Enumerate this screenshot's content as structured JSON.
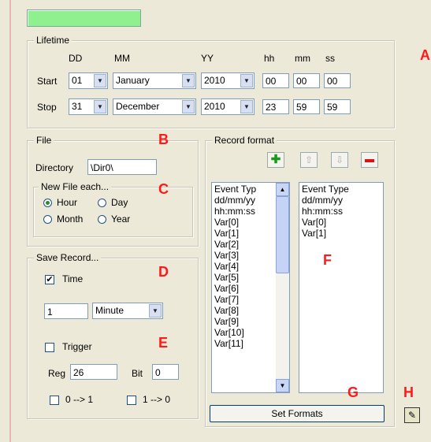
{
  "markers": {
    "A": "A",
    "B": "B",
    "C": "C",
    "D": "D",
    "E": "E",
    "F": "F",
    "G": "G",
    "H": "H"
  },
  "lifetime": {
    "legend": "Lifetime",
    "headers": {
      "dd": "DD",
      "mm": "MM",
      "yy": "YY",
      "hh": "hh",
      "min": "mm",
      "ss": "ss"
    },
    "start": {
      "label": "Start",
      "day": "01",
      "month": "January",
      "year": "2010",
      "hh": "00",
      "mm": "00",
      "ss": "00"
    },
    "stop": {
      "label": "Stop",
      "day": "31",
      "month": "December",
      "year": "2010",
      "hh": "23",
      "mm": "59",
      "ss": "59"
    }
  },
  "file": {
    "legend": "File",
    "directory_label": "Directory",
    "directory_value": "\\Dir0\\",
    "newfile_legend": "New File each...",
    "options": {
      "hour": "Hour",
      "day": "Day",
      "month": "Month",
      "year": "Year"
    },
    "selected": "Hour"
  },
  "save_record": {
    "legend": "Save Record...",
    "time_label": "Time",
    "time_checked": true,
    "interval_value": "1",
    "interval_unit": "Minute",
    "trigger_label": "Trigger",
    "trigger_checked": false,
    "reg_label": "Reg",
    "reg_value": "26",
    "bit_label": "Bit",
    "bit_value": "0",
    "edge_rising": "0 --> 1",
    "edge_falling": "1 --> 0"
  },
  "record_format": {
    "legend": "Record format",
    "available": [
      "Event Typ",
      "dd/mm/yy",
      "hh:mm:ss",
      "Var[0]",
      "Var[1]",
      "Var[2]",
      "Var[3]",
      "Var[4]",
      "Var[5]",
      "Var[6]",
      "Var[7]",
      "Var[8]",
      "Var[9]",
      "Var[10]",
      "Var[11]"
    ],
    "selected": [
      "Event Type",
      "dd/mm/yy",
      "hh:mm:ss",
      "Var[0]",
      "Var[1]"
    ],
    "set_formats_label": "Set Formats"
  }
}
